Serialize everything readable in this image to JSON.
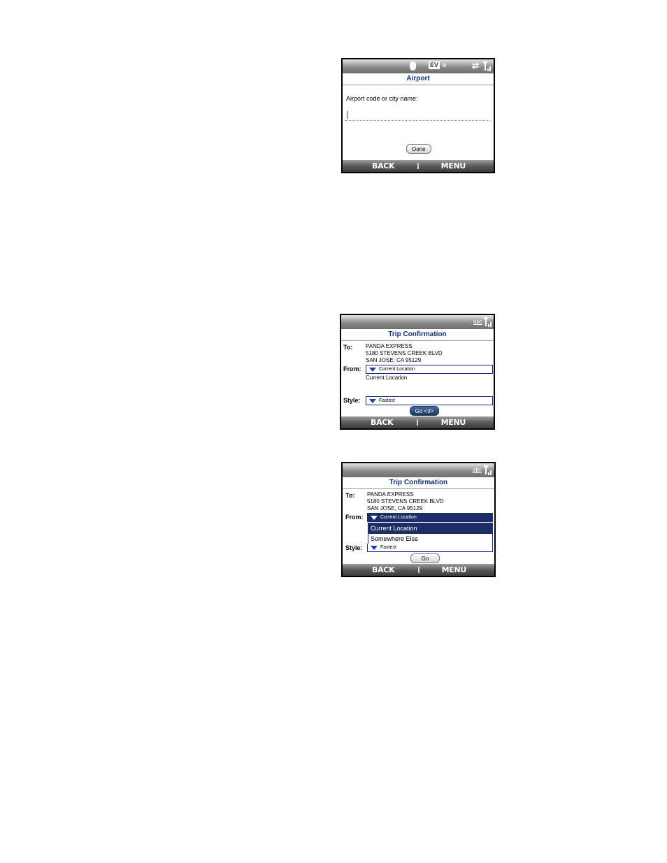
{
  "airport_screen": {
    "title": "Airport",
    "prompt": "Airport code or city name:",
    "input_value": "",
    "done_label": "Done",
    "status_icons": [
      "bluetooth-icon",
      "ev-icon",
      "data-icon",
      "sync-icon",
      "signal-icon"
    ],
    "ev_text": "EV",
    "softkeys": {
      "back": "BACK",
      "menu": "MENU"
    }
  },
  "trip_screen_1": {
    "title": "Trip Confirmation",
    "abc": "abc",
    "to_label": "To:",
    "to_lines": [
      "PANDA EXPRESS",
      "5180 STEVENS CREEK BLVD",
      "SAN JOSE, CA 95129"
    ],
    "from_label": "From:",
    "from_value": "Current Location",
    "from_detail": "Current Location",
    "style_label": "Style:",
    "style_value": "Fastest",
    "go_label": "Go <3>",
    "softkeys": {
      "back": "BACK",
      "menu": "MENU"
    }
  },
  "trip_screen_2": {
    "title": "Trip Confirmation",
    "abc": "abc",
    "to_label": "To:",
    "to_lines": [
      "PANDA EXPRESS",
      "5180 STEVENS CREEK BLVD",
      "SAN JOSE, CA 95129"
    ],
    "from_label": "From:",
    "from_value": "Current Location",
    "options": [
      "Current Location",
      "Somewhere Else"
    ],
    "style_label": "Style:",
    "style_value": "Fastest",
    "go_label": "Go",
    "softkeys": {
      "back": "BACK",
      "menu": "MENU"
    }
  }
}
